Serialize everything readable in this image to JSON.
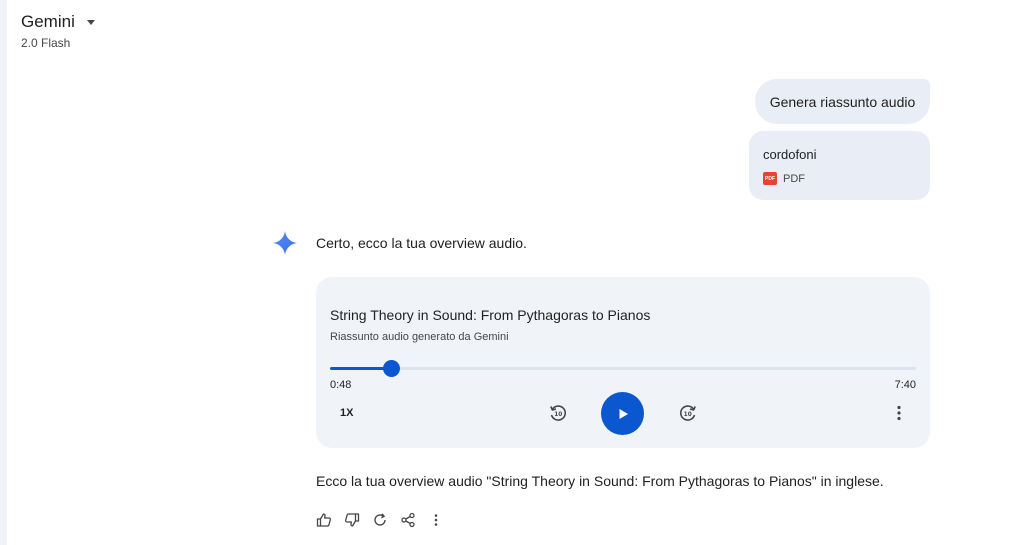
{
  "header": {
    "model_name": "Gemini",
    "model_version": "2.0 Flash"
  },
  "user_message": {
    "text": "Genera riassunto audio",
    "attachment": {
      "name": "cordofoni",
      "type": "PDF",
      "icon": "pdf-icon",
      "icon_text": "PDF"
    }
  },
  "response": {
    "intro": "Certo, ecco la tua overview audio.",
    "audio": {
      "title": "String Theory in Sound: From Pythagoras to Pianos",
      "subtitle": "Riassunto audio generato da Gemini",
      "current_time": "0:48",
      "total_time": "7:40",
      "progress_fraction": 0.104,
      "speed": "1X",
      "controls": [
        "rewind-10-icon",
        "play-icon",
        "forward-10-icon",
        "more-vert-icon"
      ]
    },
    "summary": "Ecco la tua overview audio \"String Theory in Sound: From Pythagoras to Pianos\" in inglese.",
    "actions": [
      "thumbs-up-icon",
      "thumbs-down-icon",
      "regenerate-icon",
      "share-icon",
      "more-vert-icon"
    ]
  },
  "colors": {
    "accent": "#0b57d0",
    "bubble": "#e9eef6",
    "card": "#f0f4f9",
    "pdf": "#e94235"
  }
}
